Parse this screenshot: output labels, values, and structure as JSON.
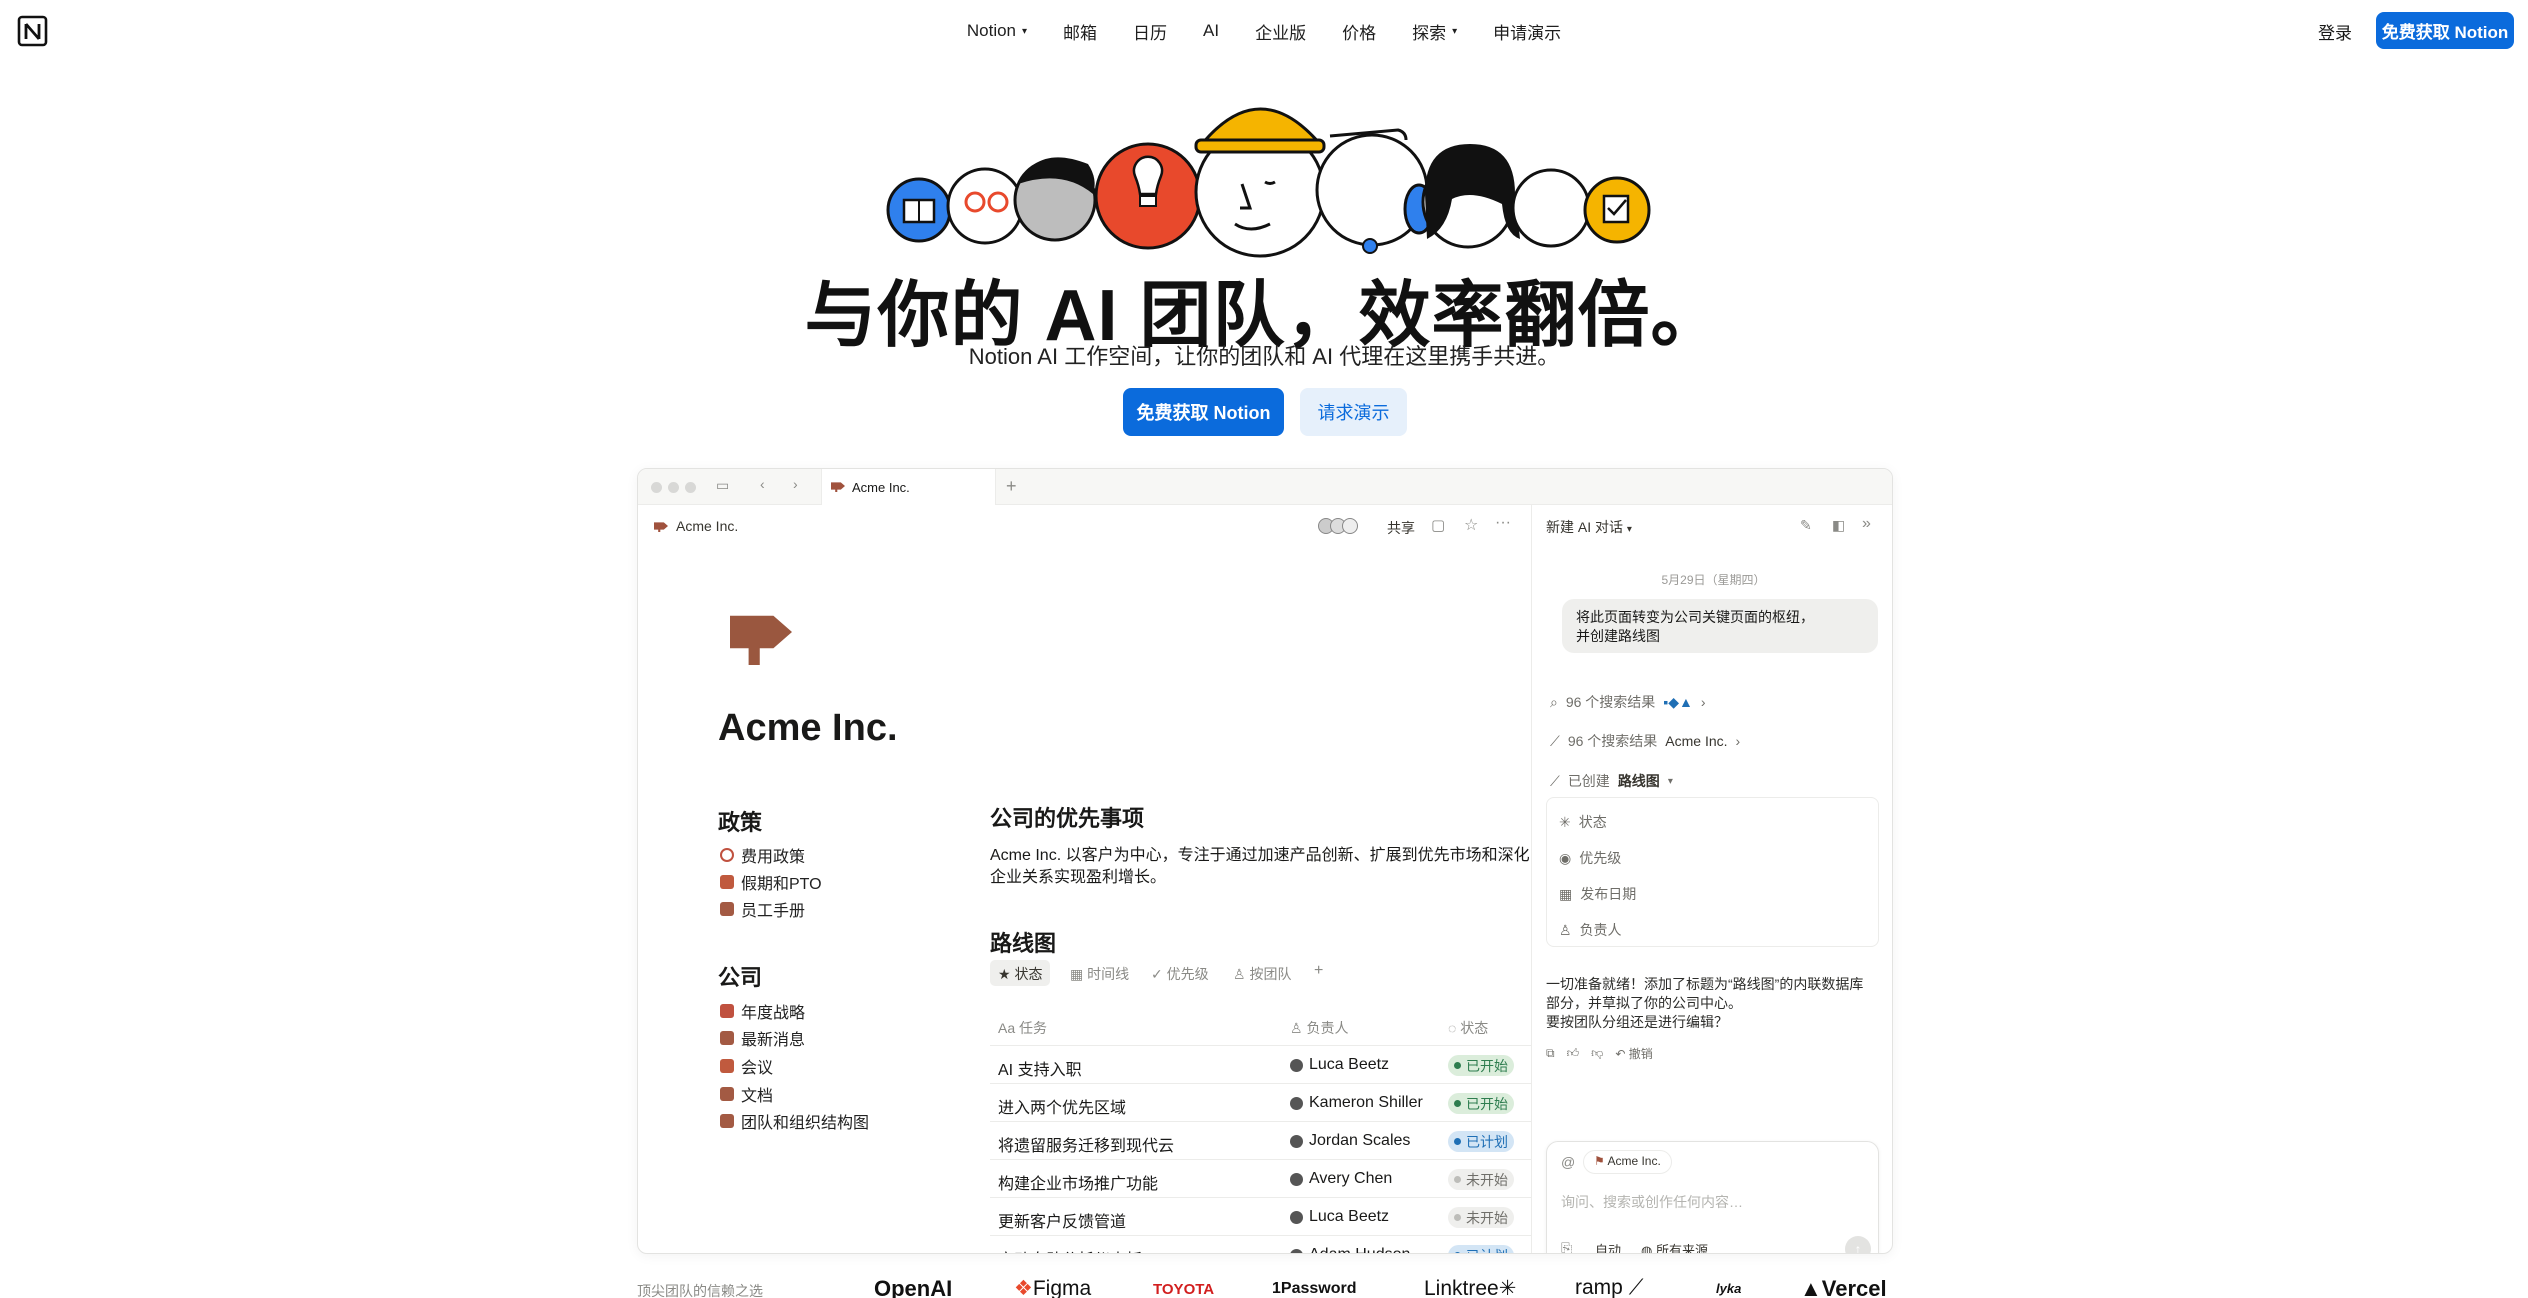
{
  "nav": {
    "items": [
      "Notion",
      "邮箱",
      "日历",
      "AI",
      "企业版",
      "价格",
      "探索",
      "申请演示"
    ],
    "login": "登录",
    "cta": "免费获取 Notion"
  },
  "hero": {
    "headline": "与你的 AI 团队，效率翻倍。",
    "subtitle": "Notion AI 工作空间，让你的团队和 AI 代理在这里携手共进。",
    "primary_cta": "免费获取 Notion",
    "secondary_cta": "请求演示"
  },
  "window": {
    "tab_title": "Acme Inc.",
    "breadcrumb": "Acme Inc.",
    "share": "共享",
    "page_title": "Acme Inc.",
    "policies_heading": "政策",
    "policies": [
      "费用政策",
      "假期和PTO",
      "员工手册"
    ],
    "company_heading": "公司",
    "company_items": [
      "年度战略",
      "最新消息",
      "会议",
      "文档",
      "团队和组织结构图"
    ],
    "priorities_heading": "公司的优先事项",
    "priorities_text_1": "Acme Inc. 以客户为中心，专注于通过加速产品创新、扩展到优先市场和深化",
    "priorities_text_2": "企业关系实现盈利增长。",
    "roadmap_heading": "路线图",
    "views": [
      "状态",
      "时间线",
      "优先级",
      "按团队"
    ],
    "columns": {
      "task": "任务",
      "owner": "负责人",
      "status": "状态"
    },
    "rows": [
      {
        "task": "AI 支持入职",
        "owner": "Luca Beetz",
        "status": "已开始"
      },
      {
        "task": "进入两个优先区域",
        "owner": "Kameron Shiller",
        "status": "已开始"
      },
      {
        "task": "将遗留服务迁移到现代云",
        "owner": "Jordan Scales",
        "status": "已计划"
      },
      {
        "task": "构建企业市场推广功能",
        "owner": "Avery Chen",
        "status": "未开始"
      },
      {
        "task": "更新客户反馈管道",
        "owner": "Luca Beetz",
        "status": "未开始"
      },
      {
        "task": "启动自助分析仪表板",
        "owner": "Adam Hudson",
        "status": "已计划"
      }
    ],
    "status_colors": {
      "已开始": "#2e7d4f",
      "已计划": "#1f6fb5",
      "未开始": "#6f6e69"
    }
  },
  "ai_panel": {
    "title": "新建 AI 对话",
    "date": "5月29日（星期四）",
    "user_msg_1": "将此页面转变为公司关键页面的枢纽，",
    "user_msg_2": "并创建路线图",
    "search_1": "96 个搜索结果",
    "search_2": "96 个搜索结果",
    "search_2_target": "Acme Inc.",
    "created": "已创建",
    "created_target": "路线图",
    "props": [
      "状态",
      "优先级",
      "发布日期",
      "负责人"
    ],
    "reply_1": "一切准备就绪！添加了标题为“路线图”的内联数据库",
    "reply_2": "部分，并草拟了你的公司中心。",
    "reply_3": "要按团队分组还是进行编辑？",
    "undo": "撤销",
    "context_chip": "Acme Inc.",
    "input_placeholder": "询问、搜索或创作任何内容…",
    "mode": "自动",
    "sources": "所有来源"
  },
  "trust": {
    "label": "顶尖团队的信赖之选",
    "logos": [
      "OpenAI",
      "Figma",
      "TOYOTA",
      "1Password",
      "Linktree",
      "ramp",
      "lyka",
      "Vercel"
    ]
  }
}
